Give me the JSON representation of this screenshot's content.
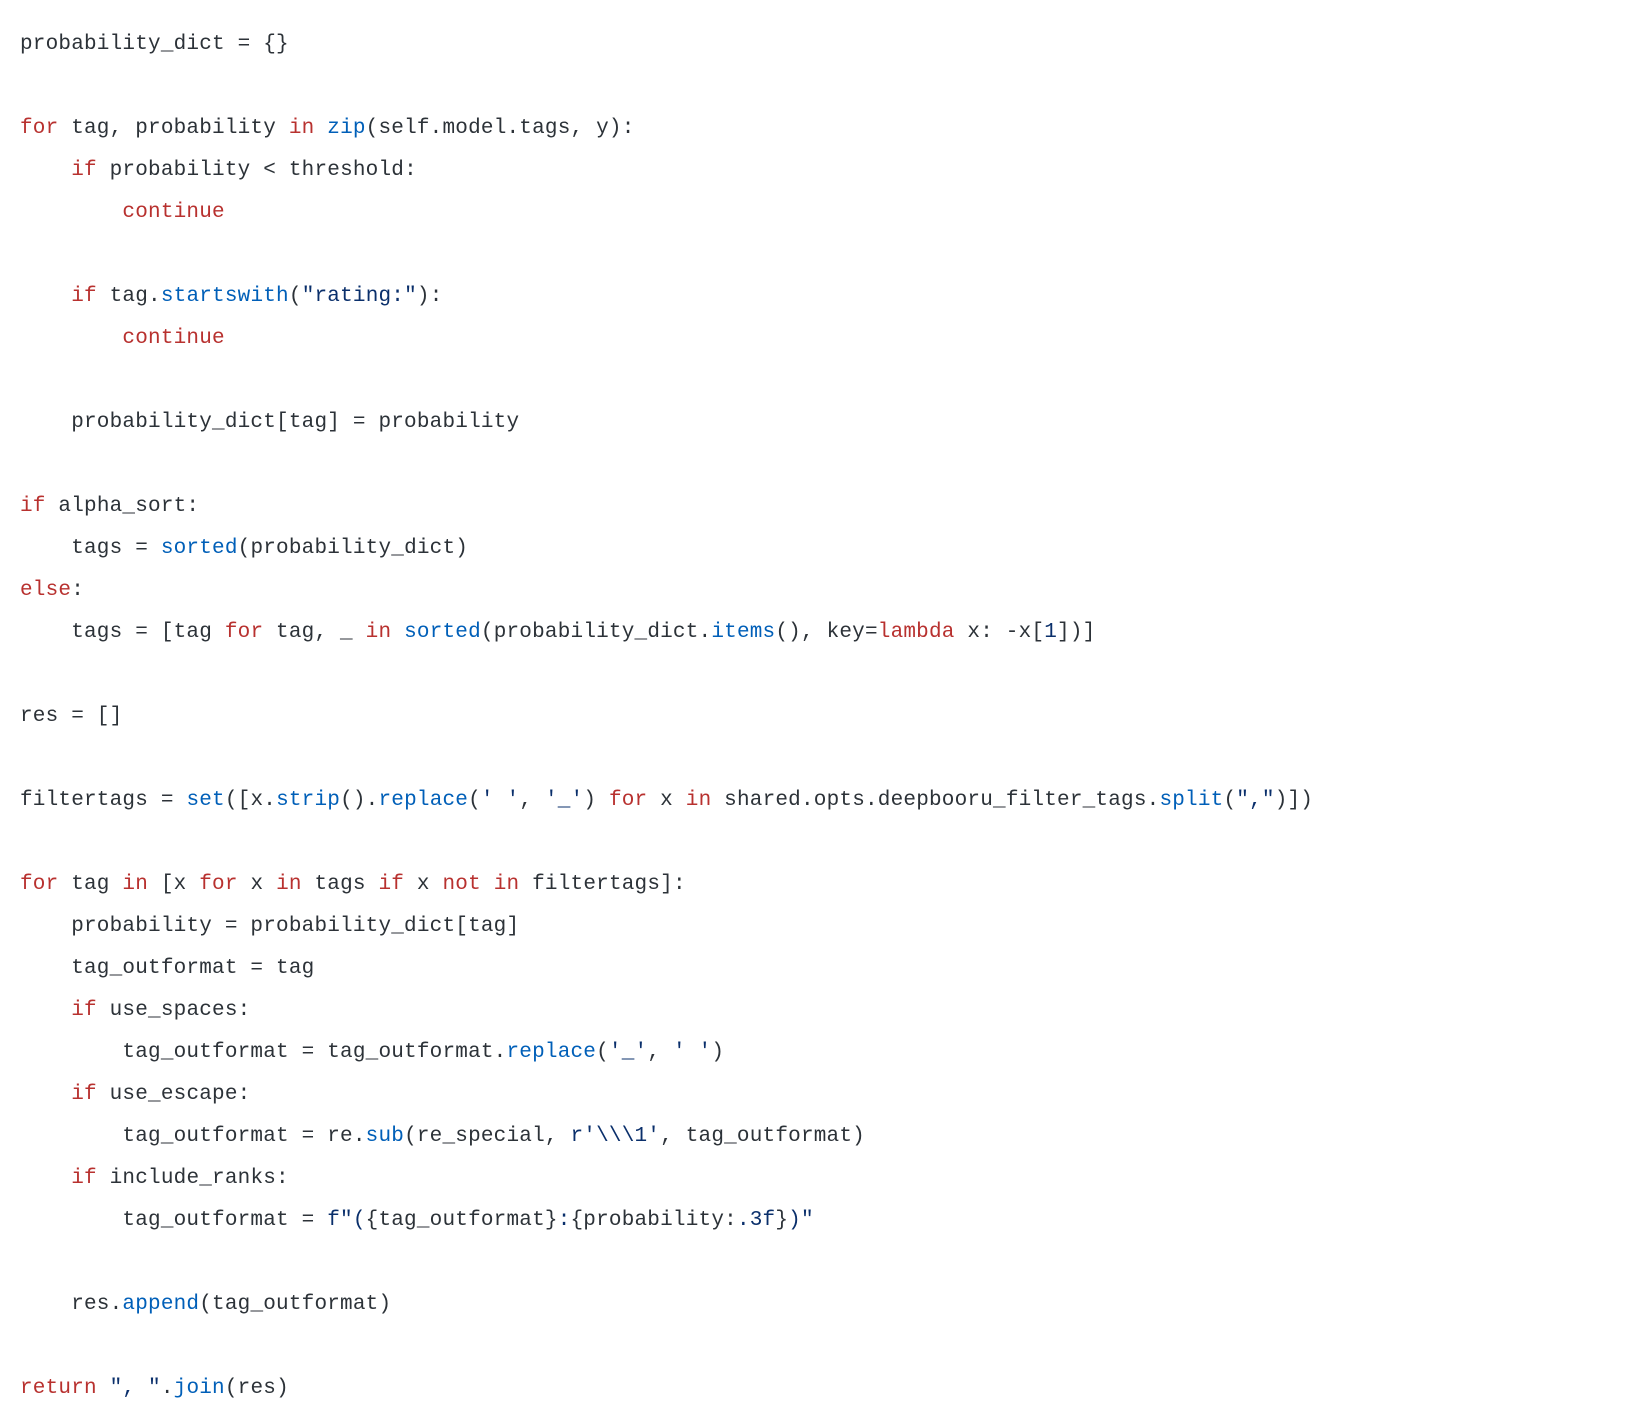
{
  "code": {
    "tokens": [
      [
        [
          "probability_dict = {}",
          ""
        ]
      ],
      [],
      [
        [
          "for",
          "kw"
        ],
        [
          " tag, probability ",
          ""
        ],
        [
          "in",
          "kw"
        ],
        [
          " ",
          ""
        ],
        [
          "zip",
          "call"
        ],
        [
          "(self.model.tags, y):",
          ""
        ]
      ],
      [
        [
          "    ",
          ""
        ],
        [
          "if",
          "kw"
        ],
        [
          " probability < threshold:",
          ""
        ]
      ],
      [
        [
          "        ",
          ""
        ],
        [
          "continue",
          "kw"
        ]
      ],
      [],
      [
        [
          "    ",
          ""
        ],
        [
          "if",
          "kw"
        ],
        [
          " tag.",
          ""
        ],
        [
          "startswith",
          "call"
        ],
        [
          "(",
          ""
        ],
        [
          "\"rating:\"",
          "str"
        ],
        [
          "):",
          ""
        ]
      ],
      [
        [
          "        ",
          ""
        ],
        [
          "continue",
          "kw"
        ]
      ],
      [],
      [
        [
          "    probability_dict[tag] = probability",
          ""
        ]
      ],
      [],
      [
        [
          "if",
          "kw"
        ],
        [
          " alpha_sort:",
          ""
        ]
      ],
      [
        [
          "    tags = ",
          ""
        ],
        [
          "sorted",
          "call"
        ],
        [
          "(probability_dict)",
          ""
        ]
      ],
      [
        [
          "else",
          "kw"
        ],
        [
          ":",
          ""
        ]
      ],
      [
        [
          "    tags = [tag ",
          ""
        ],
        [
          "for",
          "kw"
        ],
        [
          " tag, _ ",
          ""
        ],
        [
          "in",
          "kw"
        ],
        [
          " ",
          ""
        ],
        [
          "sorted",
          "call"
        ],
        [
          "(probability_dict.",
          ""
        ],
        [
          "items",
          "call"
        ],
        [
          "(), key=",
          ""
        ],
        [
          "lambda",
          "kw"
        ],
        [
          " x: -x[",
          ""
        ],
        [
          "1",
          "num"
        ],
        [
          "])]",
          ""
        ]
      ],
      [],
      [
        [
          "res = []",
          ""
        ]
      ],
      [],
      [
        [
          "filtertags = ",
          ""
        ],
        [
          "set",
          "call"
        ],
        [
          "([x.",
          ""
        ],
        [
          "strip",
          "call"
        ],
        [
          "().",
          ""
        ],
        [
          "replace",
          "call"
        ],
        [
          "(",
          ""
        ],
        [
          "' '",
          "str"
        ],
        [
          ", ",
          ""
        ],
        [
          "'_'",
          "str"
        ],
        [
          ") ",
          ""
        ],
        [
          "for",
          "kw"
        ],
        [
          " x ",
          ""
        ],
        [
          "in",
          "kw"
        ],
        [
          " shared.opts.deepbooru_filter_tags.",
          ""
        ],
        [
          "split",
          "call"
        ],
        [
          "(",
          ""
        ],
        [
          "\",\"",
          "str"
        ],
        [
          ")])",
          ""
        ]
      ],
      [],
      [
        [
          "for",
          "kw"
        ],
        [
          " tag ",
          ""
        ],
        [
          "in",
          "kw"
        ],
        [
          " [x ",
          ""
        ],
        [
          "for",
          "kw"
        ],
        [
          " x ",
          ""
        ],
        [
          "in",
          "kw"
        ],
        [
          " tags ",
          ""
        ],
        [
          "if",
          "kw"
        ],
        [
          " x ",
          ""
        ],
        [
          "not",
          "kw"
        ],
        [
          " ",
          ""
        ],
        [
          "in",
          "kw"
        ],
        [
          " filtertags]:",
          ""
        ]
      ],
      [
        [
          "    probability = probability_dict[tag]",
          ""
        ]
      ],
      [
        [
          "    tag_outformat = tag",
          ""
        ]
      ],
      [
        [
          "    ",
          ""
        ],
        [
          "if",
          "kw"
        ],
        [
          " use_spaces:",
          ""
        ]
      ],
      [
        [
          "        tag_outformat = tag_outformat.",
          ""
        ],
        [
          "replace",
          "call"
        ],
        [
          "(",
          ""
        ],
        [
          "'_'",
          "str"
        ],
        [
          ", ",
          ""
        ],
        [
          "' '",
          "str"
        ],
        [
          ")",
          ""
        ]
      ],
      [
        [
          "    ",
          ""
        ],
        [
          "if",
          "kw"
        ],
        [
          " use_escape:",
          ""
        ]
      ],
      [
        [
          "        tag_outformat = re.",
          ""
        ],
        [
          "sub",
          "call"
        ],
        [
          "(re_special, ",
          ""
        ],
        [
          "r'\\\\\\1'",
          "str"
        ],
        [
          ", tag_outformat)",
          ""
        ]
      ],
      [
        [
          "    ",
          ""
        ],
        [
          "if",
          "kw"
        ],
        [
          " include_ranks:",
          ""
        ]
      ],
      [
        [
          "        tag_outformat = ",
          ""
        ],
        [
          "f\"(",
          "str"
        ],
        [
          "{tag_outformat}",
          ""
        ],
        [
          ":",
          "str"
        ],
        [
          "{probability:",
          ""
        ],
        [
          ".3f",
          "str"
        ],
        [
          "}",
          ""
        ],
        [
          ")\"",
          "str"
        ]
      ],
      [],
      [
        [
          "    res.",
          ""
        ],
        [
          "append",
          "call"
        ],
        [
          "(tag_outformat)",
          ""
        ]
      ],
      [],
      [
        [
          "return",
          "kw"
        ],
        [
          " ",
          ""
        ],
        [
          "\", \"",
          "str"
        ],
        [
          ".",
          ""
        ],
        [
          "join",
          "call"
        ],
        [
          "(res)",
          ""
        ]
      ]
    ]
  }
}
